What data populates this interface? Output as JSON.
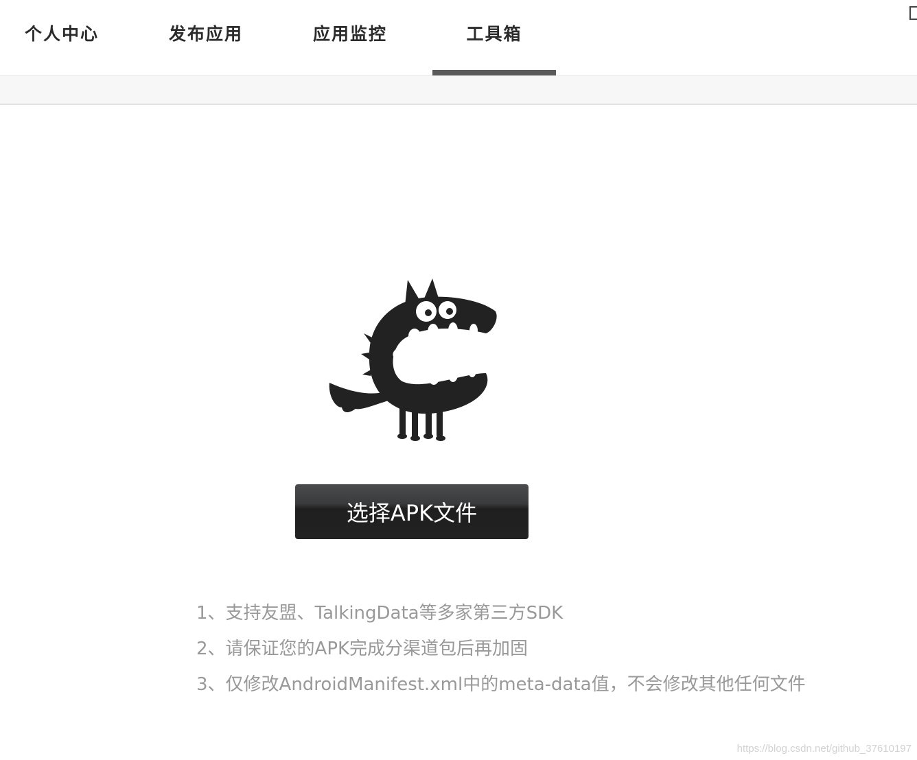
{
  "nav": {
    "tabs": [
      {
        "label": "个人中心"
      },
      {
        "label": "发布应用"
      },
      {
        "label": "应用监控"
      },
      {
        "label": "工具箱",
        "active": true
      }
    ]
  },
  "main": {
    "mascot_icon": "wolf-mascot-icon",
    "upload_button_label": "选择APK文件",
    "notes": [
      "1、支持友盟、TalkingData等多家第三方SDK",
      "2、请保证您的APK完成分渠道包后再加固",
      "3、仅修改AndroidManifest.xml中的meta-data值，不会修改其他任何文件"
    ]
  },
  "watermark": "https://blog.csdn.net/github_37610197",
  "colors": {
    "tab_underline": "#5a5a5a",
    "button_bg": "#222222",
    "note_text": "#999999"
  }
}
